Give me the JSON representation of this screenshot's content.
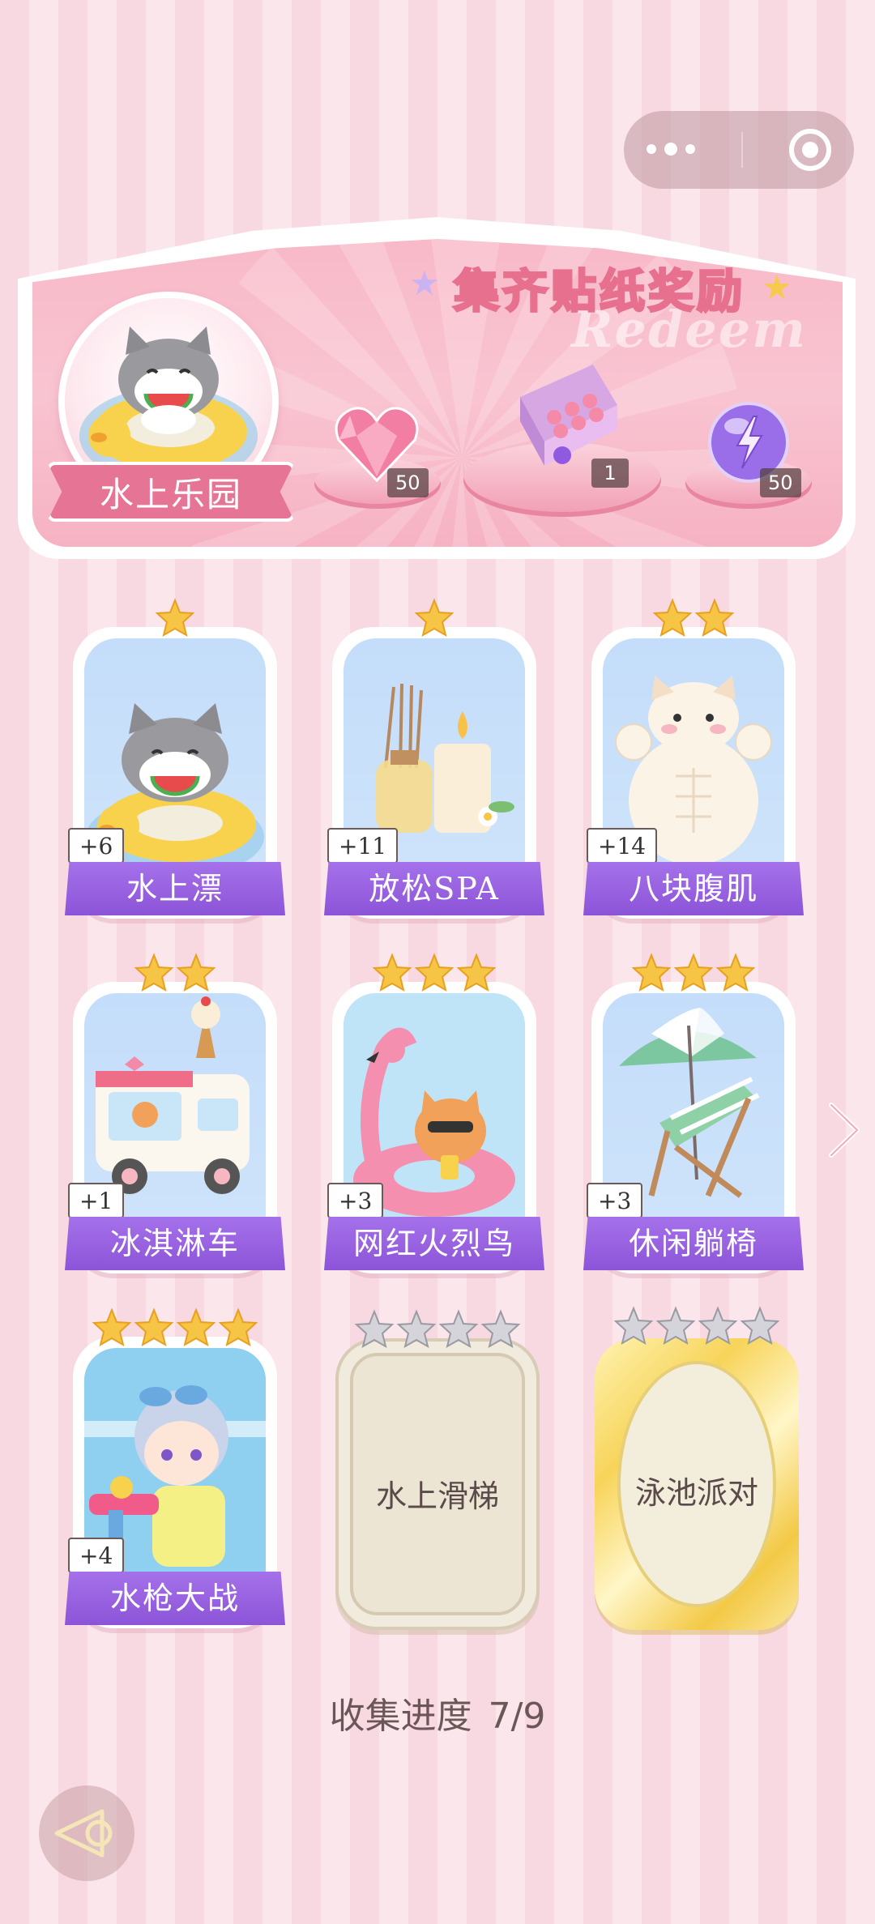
{
  "banner": {
    "title": "集齐贴纸奖励",
    "watermark": "Redeem",
    "avatar_label": "水上乐园",
    "rewards": [
      {
        "icon": "pink-heart-gem-icon",
        "count": "50"
      },
      {
        "icon": "gift-box-icon",
        "count": "1"
      },
      {
        "icon": "purple-lightning-orb-icon",
        "count": "50"
      }
    ]
  },
  "cards": [
    {
      "name": "水上漂",
      "bonus": "+6",
      "stars": 1,
      "icon": "cat-on-float-icon"
    },
    {
      "name": "放松SPA",
      "bonus": "+11",
      "stars": 1,
      "icon": "aroma-candle-icon"
    },
    {
      "name": "八块腹肌",
      "bonus": "+14",
      "stars": 2,
      "icon": "muscle-cat-icon"
    },
    {
      "name": "冰淇淋车",
      "bonus": "+1",
      "stars": 2,
      "icon": "ice-cream-truck-icon"
    },
    {
      "name": "网红火烈鸟",
      "bonus": "+3",
      "stars": 3,
      "icon": "flamingo-float-icon"
    },
    {
      "name": "休闲躺椅",
      "bonus": "+3",
      "stars": 3,
      "icon": "beach-chair-icon"
    },
    {
      "name": "水枪大战",
      "bonus": "+4",
      "stars": 4,
      "icon": "water-gun-boy-icon"
    },
    {
      "name": "水上滑梯",
      "bonus": "",
      "stars": 4,
      "icon": "locked-card"
    },
    {
      "name": "泳池派对",
      "bonus": "",
      "stars": 4,
      "icon": "locked-gold-card"
    }
  ],
  "progress": {
    "label": "收集进度",
    "value": "7/9"
  },
  "colors": {
    "accent_purple": "#9560df",
    "star_gold": "#f6c545",
    "star_silver": "#c9c9cf",
    "title_pink": "#e8708f"
  }
}
